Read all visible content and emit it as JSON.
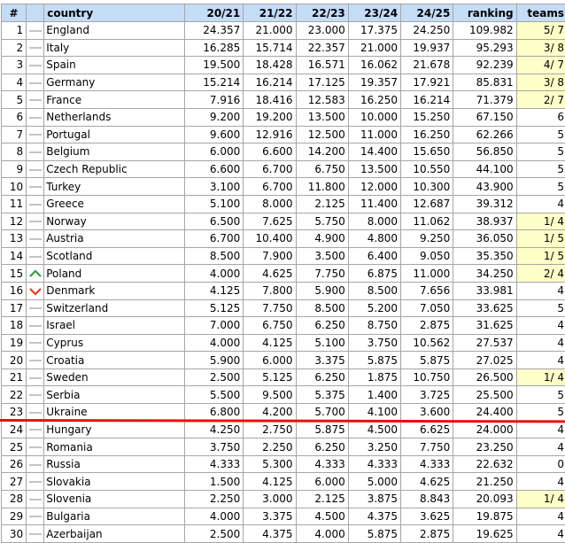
{
  "columns": {
    "rank": "#",
    "trend": "",
    "country": "country",
    "s2021": "20/21",
    "s2122": "21/22",
    "s2223": "22/23",
    "s2324": "23/24",
    "s2425": "24/25",
    "ranking": "ranking",
    "teams": "teams"
  },
  "colors": {
    "header_bg": "#c5dcf7",
    "teams_highlight": "#ffffc8",
    "trend_up": "#3a9a4a",
    "trend_down": "#e03a2a",
    "trend_same": "#c4c4c4",
    "cutoff_line": "#e81010"
  },
  "cutoff_after_rank": 23,
  "rows": [
    {
      "pos": "1",
      "trend": "same",
      "country": "England",
      "s1": "24.357",
      "s2": "21.000",
      "s3": "23.000",
      "s4": "17.375",
      "s5": "24.250",
      "ranking": "109.982",
      "teams": "5/ 7",
      "highlight": true
    },
    {
      "pos": "2",
      "trend": "same",
      "country": "Italy",
      "s1": "16.285",
      "s2": "15.714",
      "s3": "22.357",
      "s4": "21.000",
      "s5": "19.937",
      "ranking": "95.293",
      "teams": "3/ 8",
      "highlight": true
    },
    {
      "pos": "3",
      "trend": "same",
      "country": "Spain",
      "s1": "19.500",
      "s2": "18.428",
      "s3": "16.571",
      "s4": "16.062",
      "s5": "21.678",
      "ranking": "92.239",
      "teams": "4/ 7",
      "highlight": true
    },
    {
      "pos": "4",
      "trend": "same",
      "country": "Germany",
      "s1": "15.214",
      "s2": "16.214",
      "s3": "17.125",
      "s4": "19.357",
      "s5": "17.921",
      "ranking": "85.831",
      "teams": "3/ 8",
      "highlight": true
    },
    {
      "pos": "5",
      "trend": "same",
      "country": "France",
      "s1": "7.916",
      "s2": "18.416",
      "s3": "12.583",
      "s4": "16.250",
      "s5": "16.214",
      "ranking": "71.379",
      "teams": "2/ 7",
      "highlight": true
    },
    {
      "pos": "6",
      "trend": "same",
      "country": "Netherlands",
      "s1": "9.200",
      "s2": "19.200",
      "s3": "13.500",
      "s4": "10.000",
      "s5": "15.250",
      "ranking": "67.150",
      "teams": "6",
      "highlight": false
    },
    {
      "pos": "7",
      "trend": "same",
      "country": "Portugal",
      "s1": "9.600",
      "s2": "12.916",
      "s3": "12.500",
      "s4": "11.000",
      "s5": "16.250",
      "ranking": "62.266",
      "teams": "5",
      "highlight": false
    },
    {
      "pos": "8",
      "trend": "same",
      "country": "Belgium",
      "s1": "6.000",
      "s2": "6.600",
      "s3": "14.200",
      "s4": "14.400",
      "s5": "15.650",
      "ranking": "56.850",
      "teams": "5",
      "highlight": false
    },
    {
      "pos": "9",
      "trend": "same",
      "country": "Czech Republic",
      "s1": "6.600",
      "s2": "6.700",
      "s3": "6.750",
      "s4": "13.500",
      "s5": "10.550",
      "ranking": "44.100",
      "teams": "5",
      "highlight": false
    },
    {
      "pos": "10",
      "trend": "same",
      "country": "Turkey",
      "s1": "3.100",
      "s2": "6.700",
      "s3": "11.800",
      "s4": "12.000",
      "s5": "10.300",
      "ranking": "43.900",
      "teams": "5",
      "highlight": false
    },
    {
      "pos": "11",
      "trend": "same",
      "country": "Greece",
      "s1": "5.100",
      "s2": "8.000",
      "s3": "2.125",
      "s4": "11.400",
      "s5": "12.687",
      "ranking": "39.312",
      "teams": "4",
      "highlight": false
    },
    {
      "pos": "12",
      "trend": "same",
      "country": "Norway",
      "s1": "6.500",
      "s2": "7.625",
      "s3": "5.750",
      "s4": "8.000",
      "s5": "11.062",
      "ranking": "38.937",
      "teams": "1/ 4",
      "highlight": true
    },
    {
      "pos": "13",
      "trend": "same",
      "country": "Austria",
      "s1": "6.700",
      "s2": "10.400",
      "s3": "4.900",
      "s4": "4.800",
      "s5": "9.250",
      "ranking": "36.050",
      "teams": "1/ 5",
      "highlight": true
    },
    {
      "pos": "14",
      "trend": "same",
      "country": "Scotland",
      "s1": "8.500",
      "s2": "7.900",
      "s3": "3.500",
      "s4": "6.400",
      "s5": "9.050",
      "ranking": "35.350",
      "teams": "1/ 5",
      "highlight": true
    },
    {
      "pos": "15",
      "trend": "up",
      "country": "Poland",
      "s1": "4.000",
      "s2": "4.625",
      "s3": "7.750",
      "s4": "6.875",
      "s5": "11.000",
      "ranking": "34.250",
      "teams": "2/ 4",
      "highlight": true
    },
    {
      "pos": "16",
      "trend": "down",
      "country": "Denmark",
      "s1": "4.125",
      "s2": "7.800",
      "s3": "5.900",
      "s4": "8.500",
      "s5": "7.656",
      "ranking": "33.981",
      "teams": "4",
      "highlight": false
    },
    {
      "pos": "17",
      "trend": "same",
      "country": "Switzerland",
      "s1": "5.125",
      "s2": "7.750",
      "s3": "8.500",
      "s4": "5.200",
      "s5": "7.050",
      "ranking": "33.625",
      "teams": "5",
      "highlight": false
    },
    {
      "pos": "18",
      "trend": "same",
      "country": "Israel",
      "s1": "7.000",
      "s2": "6.750",
      "s3": "6.250",
      "s4": "8.750",
      "s5": "2.875",
      "ranking": "31.625",
      "teams": "4",
      "highlight": false
    },
    {
      "pos": "19",
      "trend": "same",
      "country": "Cyprus",
      "s1": "4.000",
      "s2": "4.125",
      "s3": "5.100",
      "s4": "3.750",
      "s5": "10.562",
      "ranking": "27.537",
      "teams": "4",
      "highlight": false
    },
    {
      "pos": "20",
      "trend": "same",
      "country": "Croatia",
      "s1": "5.900",
      "s2": "6.000",
      "s3": "3.375",
      "s4": "5.875",
      "s5": "5.875",
      "ranking": "27.025",
      "teams": "4",
      "highlight": false
    },
    {
      "pos": "21",
      "trend": "same",
      "country": "Sweden",
      "s1": "2.500",
      "s2": "5.125",
      "s3": "6.250",
      "s4": "1.875",
      "s5": "10.750",
      "ranking": "26.500",
      "teams": "1/ 4",
      "highlight": true
    },
    {
      "pos": "22",
      "trend": "same",
      "country": "Serbia",
      "s1": "5.500",
      "s2": "9.500",
      "s3": "5.375",
      "s4": "1.400",
      "s5": "3.725",
      "ranking": "25.500",
      "teams": "5",
      "highlight": false
    },
    {
      "pos": "23",
      "trend": "same",
      "country": "Ukraine",
      "s1": "6.800",
      "s2": "4.200",
      "s3": "5.700",
      "s4": "4.100",
      "s5": "3.600",
      "ranking": "24.400",
      "teams": "5",
      "highlight": false
    },
    {
      "pos": "24",
      "trend": "same",
      "country": "Hungary",
      "s1": "4.250",
      "s2": "2.750",
      "s3": "5.875",
      "s4": "4.500",
      "s5": "6.625",
      "ranking": "24.000",
      "teams": "4",
      "highlight": false
    },
    {
      "pos": "25",
      "trend": "same",
      "country": "Romania",
      "s1": "3.750",
      "s2": "2.250",
      "s3": "6.250",
      "s4": "3.250",
      "s5": "7.750",
      "ranking": "23.250",
      "teams": "4",
      "highlight": false
    },
    {
      "pos": "26",
      "trend": "same",
      "country": "Russia",
      "s1": "4.333",
      "s2": "5.300",
      "s3": "4.333",
      "s4": "4.333",
      "s5": "4.333",
      "ranking": "22.632",
      "teams": "0",
      "highlight": false
    },
    {
      "pos": "27",
      "trend": "same",
      "country": "Slovakia",
      "s1": "1.500",
      "s2": "4.125",
      "s3": "6.000",
      "s4": "5.000",
      "s5": "4.625",
      "ranking": "21.250",
      "teams": "4",
      "highlight": false
    },
    {
      "pos": "28",
      "trend": "same",
      "country": "Slovenia",
      "s1": "2.250",
      "s2": "3.000",
      "s3": "2.125",
      "s4": "3.875",
      "s5": "8.843",
      "ranking": "20.093",
      "teams": "1/ 4",
      "highlight": true
    },
    {
      "pos": "29",
      "trend": "same",
      "country": "Bulgaria",
      "s1": "4.000",
      "s2": "3.375",
      "s3": "4.500",
      "s4": "4.375",
      "s5": "3.625",
      "ranking": "19.875",
      "teams": "4",
      "highlight": false
    },
    {
      "pos": "30",
      "trend": "same",
      "country": "Azerbaijan",
      "s1": "2.500",
      "s2": "4.375",
      "s3": "4.000",
      "s4": "5.875",
      "s5": "2.875",
      "ranking": "19.625",
      "teams": "4",
      "highlight": false
    }
  ]
}
